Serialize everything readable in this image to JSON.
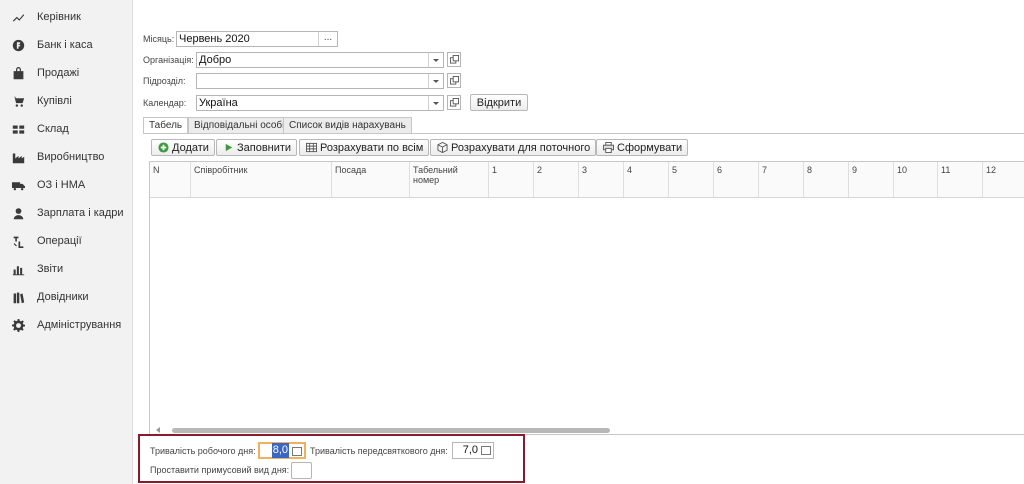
{
  "sidebar": {
    "items": [
      {
        "icon": "trend-icon",
        "label": "Керівник"
      },
      {
        "icon": "bank-icon",
        "label": "Банк і каса"
      },
      {
        "icon": "bag-icon",
        "label": "Продажі"
      },
      {
        "icon": "cart-icon",
        "label": "Купівлі"
      },
      {
        "icon": "warehouse-icon",
        "label": "Склад"
      },
      {
        "icon": "factory-icon",
        "label": "Виробництво"
      },
      {
        "icon": "truck-icon",
        "label": "ОЗ і НМА"
      },
      {
        "icon": "person-icon",
        "label": "Зарплата і кадри"
      },
      {
        "icon": "operations-icon",
        "label": "Операції"
      },
      {
        "icon": "bar-chart-icon",
        "label": "Звіти"
      },
      {
        "icon": "books-icon",
        "label": "Довідники"
      },
      {
        "icon": "gear-icon",
        "label": "Адміністрування"
      }
    ]
  },
  "form": {
    "month_label": "Місяць:",
    "month_value": "Червень 2020",
    "month_button": "...",
    "org_label": "Організація:",
    "org_value": "Добро",
    "dept_label": "Підрозділ:",
    "dept_value": "",
    "calendar_label": "Календар:",
    "calendar_value": "Україна",
    "open_button": "Відкрити"
  },
  "tabs": [
    {
      "label": "Табель",
      "active": true
    },
    {
      "label": "Відповідальні особи",
      "active": false
    },
    {
      "label": "Список видів нарахувань",
      "active": false
    }
  ],
  "toolbar": {
    "add": "Додати",
    "fill": "Заповнити",
    "calc_all": "Розрахувати по всім",
    "calc_current": "Розрахувати для поточного",
    "generate": "Сформувати"
  },
  "table": {
    "columns": [
      "N",
      "Співробітник",
      "Посада",
      "Табельний номер",
      "1",
      "2",
      "3",
      "4",
      "5",
      "6",
      "7",
      "8",
      "9",
      "10",
      "11",
      "12"
    ]
  },
  "bottom": {
    "workday_label": "Тривалість робочого дня:",
    "workday_value": "8,0",
    "preholiday_label": "Тривалість передсвяткового дня:",
    "preholiday_value": "7,0",
    "force_label": "Проставити примусовий вид дня:",
    "force_value": ""
  }
}
